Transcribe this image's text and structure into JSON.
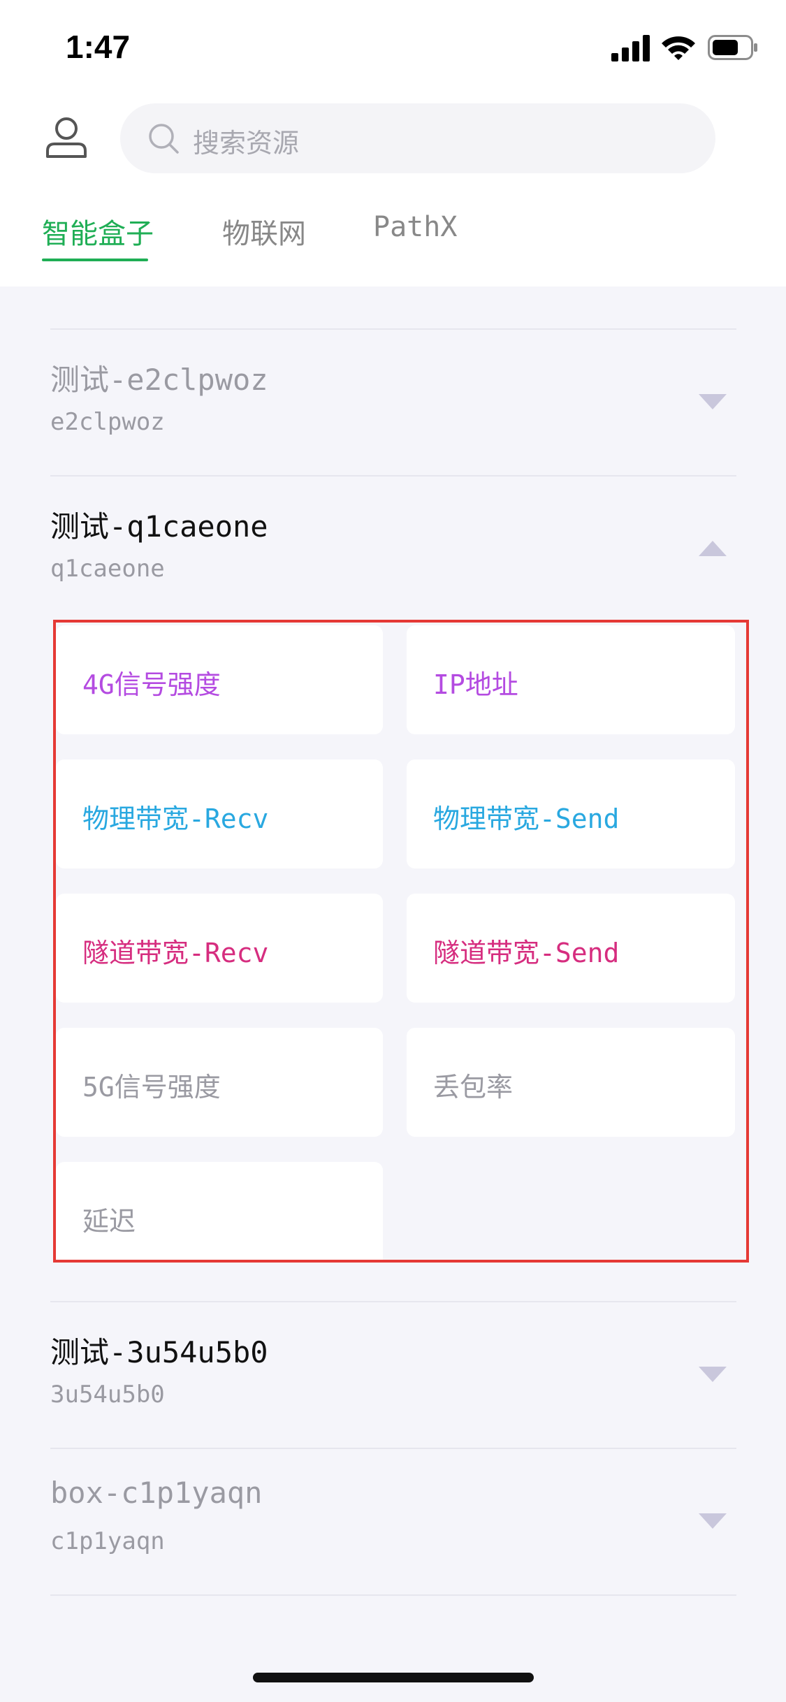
{
  "status_bar": {
    "time": "1:47"
  },
  "search": {
    "placeholder": "搜索资源"
  },
  "tabs": [
    {
      "label": "智能盒子",
      "active": true
    },
    {
      "label": "物联网",
      "active": false
    },
    {
      "label": "PathX",
      "active": false
    }
  ],
  "devices": [
    {
      "name": "测试-e2clpwoz",
      "id": "e2clpwoz",
      "expanded": false,
      "name_color": "#9a9aa2"
    },
    {
      "name": "测试-q1caeone",
      "id": "q1caeone",
      "expanded": true,
      "name_color": "#111111"
    },
    {
      "name": "测试-3u54u5b0",
      "id": "3u54u5b0",
      "expanded": false,
      "name_color": "#111111"
    },
    {
      "name": "box-c1p1yaqn",
      "id": "c1p1yaqn",
      "expanded": false,
      "name_color": "#9a9aa2"
    }
  ],
  "metrics": [
    {
      "label": "4G信号强度",
      "color": "#b44be1"
    },
    {
      "label": "IP地址",
      "color": "#b44be1"
    },
    {
      "label": "物理带宽-Recv",
      "color": "#29a8e0"
    },
    {
      "label": "物理带宽-Send",
      "color": "#29a8e0"
    },
    {
      "label": "隧道带宽-Recv",
      "color": "#d62d7f"
    },
    {
      "label": "隧道带宽-Send",
      "color": "#d62d7f"
    },
    {
      "label": "5G信号强度",
      "color": "#9a9aa2"
    },
    {
      "label": "丢包率",
      "color": "#9a9aa2"
    },
    {
      "label": "延迟",
      "color": "#9a9aa2"
    }
  ],
  "colors": {
    "accent": "#1fae55",
    "highlight_border": "#e53935"
  }
}
